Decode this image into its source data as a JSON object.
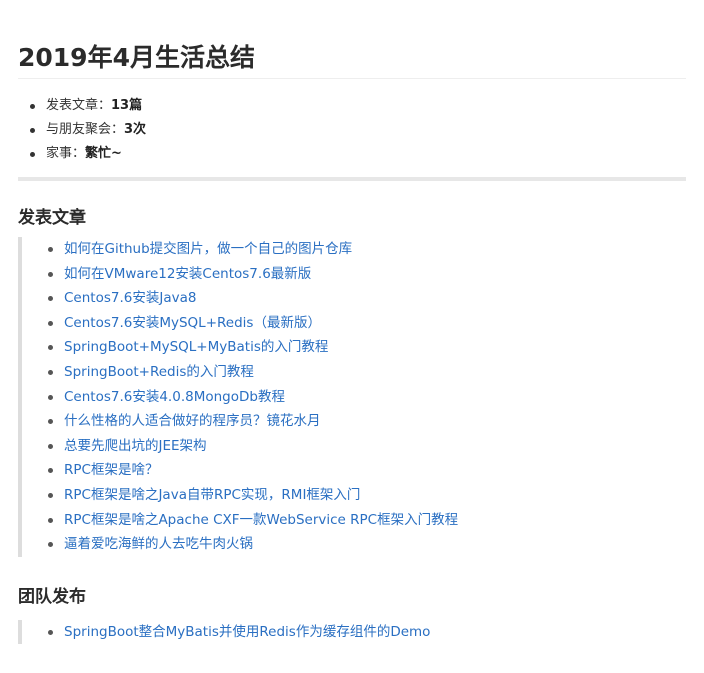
{
  "document": {
    "title": "2019年4月生活总结"
  },
  "summary": [
    {
      "label": "发表文章：",
      "value": "13篇"
    },
    {
      "label": "与朋友聚会：",
      "value": "3次"
    },
    {
      "label": "家事：",
      "value": "繁忙~"
    }
  ],
  "sections": {
    "articles": {
      "heading": "发表文章",
      "items": [
        "如何在Github提交图片，做一个自己的图片仓库",
        "如何在VMware12安装Centos7.6最新版",
        "Centos7.6安装Java8",
        "Centos7.6安装MySQL+Redis（最新版）",
        "SpringBoot+MySQL+MyBatis的入门教程",
        "SpringBoot+Redis的入门教程",
        "Centos7.6安装4.0.8MongoDb教程",
        "什么性格的人适合做好的程序员？镜花水月",
        "总要先爬出坑的JEE架构",
        "RPC框架是啥？",
        "RPC框架是啥之Java自带RPC实现，RMI框架入门",
        "RPC框架是啥之Apache CXF一款WebService RPC框架入门教程",
        "逼着爱吃海鲜的人去吃牛肉火锅"
      ]
    },
    "team": {
      "heading": "团队发布",
      "items": [
        "SpringBoot整合MyBatis并使用Redis作为缓存组件的Demo"
      ]
    }
  },
  "colors": {
    "link": "#2a6fc2",
    "text": "#333333",
    "rule": "#e7e7e7",
    "quote_border": "#dddddd"
  }
}
